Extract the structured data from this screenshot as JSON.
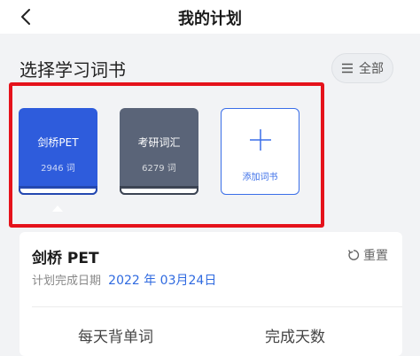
{
  "header": {
    "title": "我的计划"
  },
  "section": {
    "title": "选择学习词书",
    "all_button": "全部"
  },
  "books": [
    {
      "name": "剑桥PET",
      "count": "2946 词",
      "color": "#2e5cdc",
      "selected": true
    },
    {
      "name": "考研词汇",
      "count": "6279 词",
      "color": "#5a6478",
      "selected": false
    }
  ],
  "add_book": {
    "label": "添加词书"
  },
  "plan": {
    "book_title": "剑桥 PET",
    "reset_label": "重置",
    "date_label": "计划完成日期",
    "date_value": "2022 年 03月24日",
    "columns": [
      "每天背单词",
      "完成天数"
    ]
  },
  "colors": {
    "accent": "#2f6ae0",
    "highlight": "#e5121b"
  }
}
